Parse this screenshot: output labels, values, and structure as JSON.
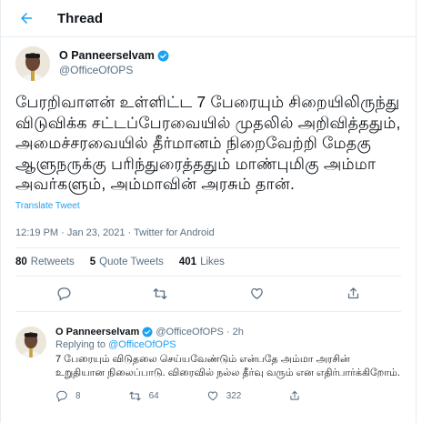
{
  "header": {
    "title": "Thread"
  },
  "tweet": {
    "author_name": "O Panneerselvam",
    "author_handle": "@OfficeOfOPS",
    "text": "பேரறிவாளன் உள்ளிட்ட 7 பேரையும் சிறையிலிருந்து விடுவிக்க சட்டப்பேரவையில் முதலில் அறிவித்ததும், அமைச்சரவையில் தீர்மானம் நிறைவேற்றி மேதகு ஆளுநருக்கு பரிந்துரைத்ததும் மாண்புமிகு அம்மா அவர்களும், அம்மாவின் அரசும் தான்.",
    "translate_label": "Translate Tweet",
    "meta": "12:19 PM · Jan 23, 2021 · Twitter for Android",
    "stats": {
      "retweets_count": "80",
      "retweets_label": "Retweets",
      "quotes_count": "5",
      "quotes_label": "Quote Tweets",
      "likes_count": "401",
      "likes_label": "Likes"
    }
  },
  "reply": {
    "author_name": "O Panneerselvam",
    "author_handle": "@OfficeOfOPS",
    "time": "· 2h",
    "replying_prefix": "Replying to ",
    "replying_to": "@OfficeOfOPS",
    "text": "7 பேரையும் விடுதலை செய்யவேண்டும் என்பதே அம்மா அரசின் உறுதியான நிலைப்பாடு. விரைவில் நல்ல தீர்வு வரும் என எதிர்பார்க்கிறோம்.",
    "replies": "8",
    "retweets": "64",
    "likes": "322"
  },
  "colors": {
    "accent": "#1da1f2",
    "verified": "#1da1f2"
  },
  "icons": [
    "back-arrow-icon",
    "verified-badge-icon",
    "reply-icon",
    "retweet-icon",
    "like-icon",
    "share-icon"
  ]
}
